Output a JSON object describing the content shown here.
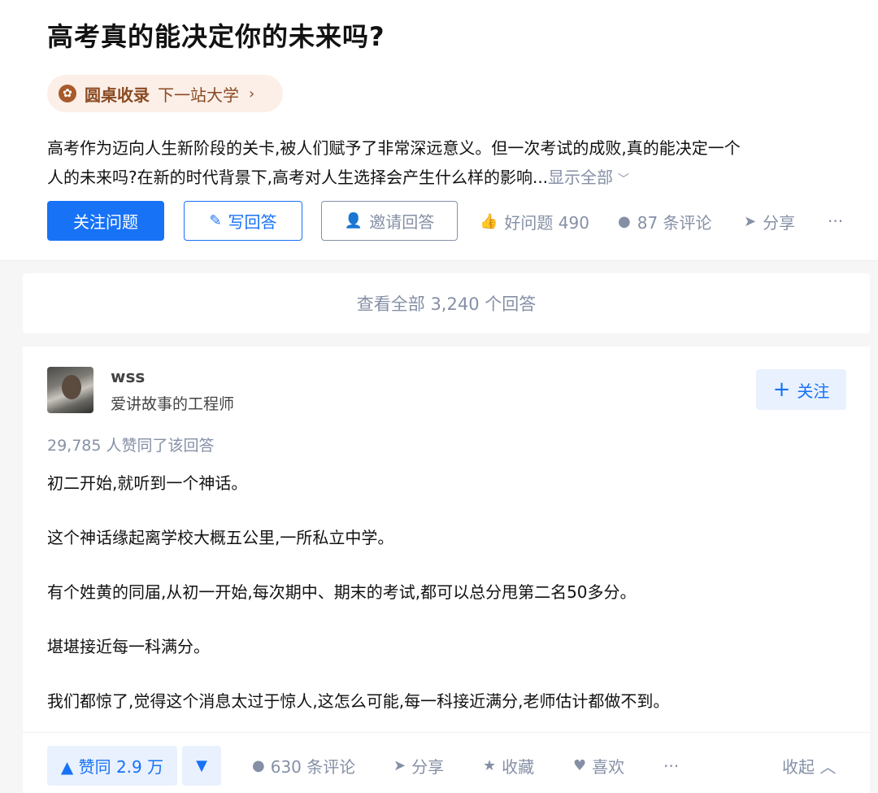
{
  "question": {
    "title": "高考真的能决定你的未来吗?",
    "roundtable": {
      "label": "圆桌收录",
      "name": "下一站大学",
      "chevron": "›"
    },
    "description_line1": "高考作为迈向人生新阶段的关卡,被人们赋予了非常深远意义。但一次考试的成败,真的能决定一个",
    "description_line2": "人的未来吗?在新的时代背景下,高考对人生选择会产生什么样的影响...",
    "show_all": "显示全部",
    "show_all_chevron": "﹀",
    "buttons": {
      "follow": "关注问题",
      "write": "写回答",
      "invite": "邀请回答"
    },
    "actions": {
      "good_question": "好问题 490",
      "comments": "87 条评论",
      "share": "分享",
      "more": "···"
    }
  },
  "view_all_answers": "查看全部 3,240 个回答",
  "answer": {
    "author": {
      "name": "wss",
      "bio": "爱讲故事的工程师",
      "follow": "关注"
    },
    "vote_summary": "29,785 人赞同了该回答",
    "paragraphs": [
      "初二开始,就听到一个神话。",
      "这个神话缘起离学校大概五公里,一所私立中学。",
      "有个姓黄的同届,从初一开始,每次期中、期末的考试,都可以总分甩第二名50多分。",
      "堪堪接近每一科满分。",
      "我们都惊了,觉得这个消息太过于惊人,这怎么可能,每一科接近满分,老师估计都做不到。"
    ],
    "actions": {
      "vote_up": "▲ 赞同 2.9 万",
      "vote_down": "▼",
      "comments": "630 条评论",
      "share": "分享",
      "collect": "收藏",
      "like": "喜欢",
      "more": "···",
      "collapse": "收起 ︿"
    }
  },
  "colors": {
    "primary": "#1772f6",
    "muted": "#8590a6",
    "roundtable": "#8a4a22"
  }
}
